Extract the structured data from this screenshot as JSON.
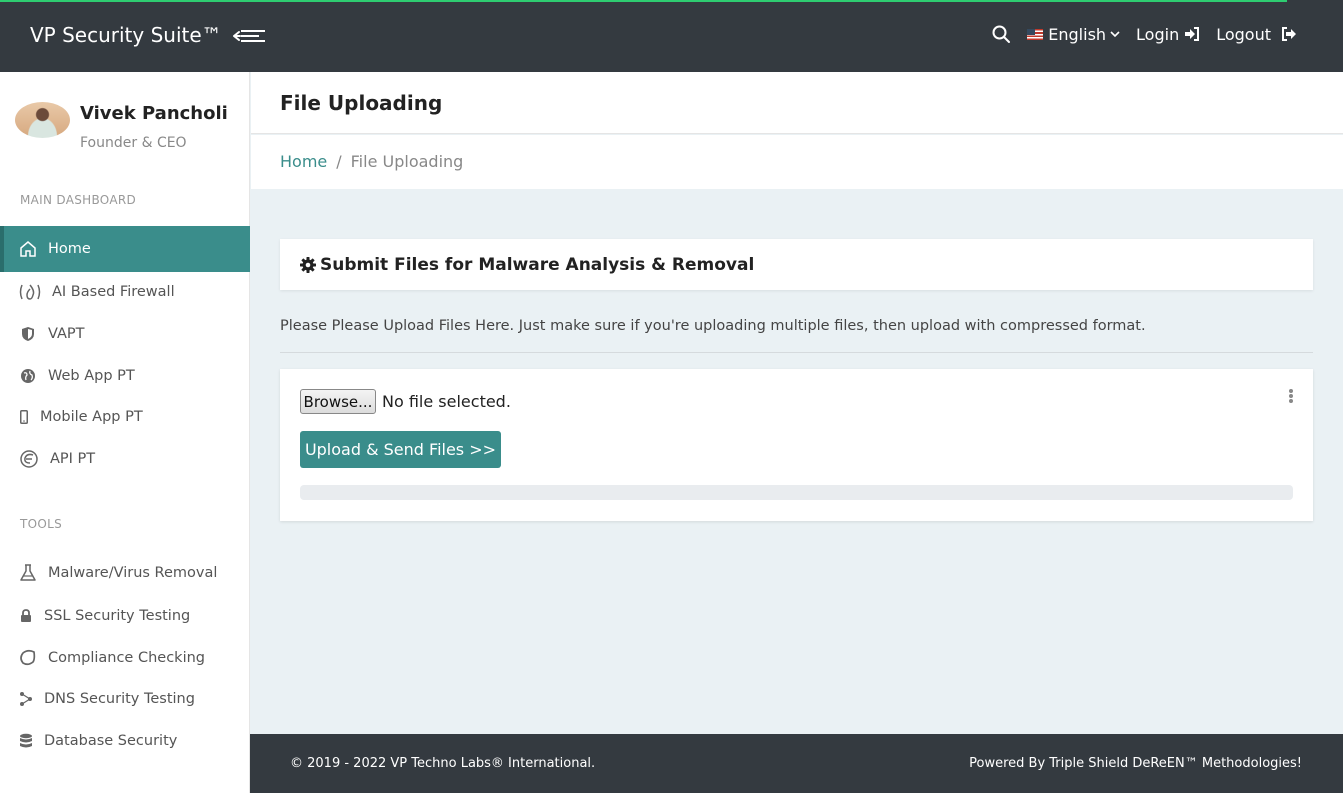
{
  "header": {
    "brand": "VP Security Suite™",
    "language": "English",
    "login_label": "Login",
    "logout_label": "Logout"
  },
  "profile": {
    "name": "Vivek Pancholi",
    "role": "Founder & CEO"
  },
  "sidebar": {
    "sections": [
      {
        "label": "MAIN DASHBOARD",
        "items": [
          {
            "label": "Home",
            "icon": "home-icon",
            "active": true
          },
          {
            "label": "AI Based Firewall",
            "icon": "fire-icon"
          },
          {
            "label": "VAPT",
            "icon": "shield-icon"
          },
          {
            "label": "Web App PT",
            "icon": "globe-icon"
          },
          {
            "label": "Mobile App PT",
            "icon": "mobile-icon"
          },
          {
            "label": "API PT",
            "icon": "api-icon"
          }
        ]
      },
      {
        "label": "TOOLS",
        "items": [
          {
            "label": "Malware/Virus Removal",
            "icon": "flask-icon"
          },
          {
            "label": "SSL Security Testing",
            "icon": "lock-icon"
          },
          {
            "label": "Compliance Checking",
            "icon": "circle-icon"
          },
          {
            "label": "DNS Security Testing",
            "icon": "network-icon"
          },
          {
            "label": "Database Security",
            "icon": "database-icon"
          }
        ]
      }
    ]
  },
  "page": {
    "title": "File Uploading",
    "breadcrumb": {
      "home": "Home",
      "separator": "/",
      "current": "File Uploading"
    }
  },
  "card": {
    "title": "Submit Files for Malware Analysis & Removal",
    "notice": "Please Please Upload Files Here. Just make sure if you're uploading multiple files, then upload with compressed format.",
    "browse_label": "Browse...",
    "file_status": "No file selected.",
    "upload_label": "Upload & Send Files >>",
    "progress": 0
  },
  "footer": {
    "copyright": "© 2019 - 2022 VP Techno Labs® International.",
    "powered_by": "Powered By Triple Shield DeReEN™ Methodologies!"
  },
  "colors": {
    "accent": "#3a8d8b",
    "topbar": "#343a40",
    "top_progress": "#2ecc71"
  }
}
